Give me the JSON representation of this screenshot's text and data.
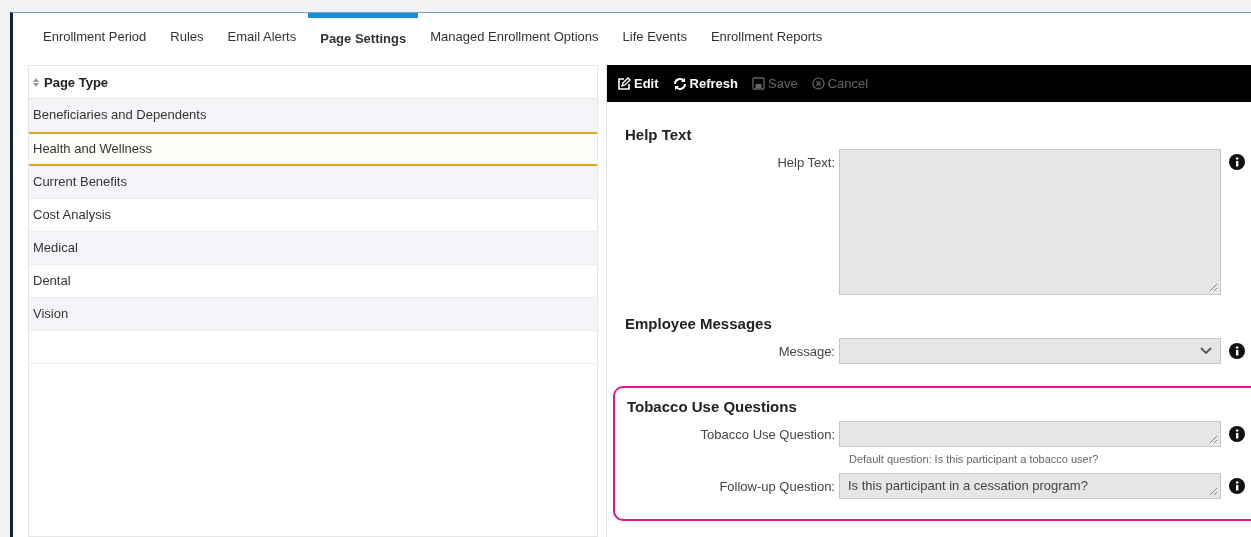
{
  "tabs": [
    {
      "label": "Enrollment Period",
      "selected": false
    },
    {
      "label": "Rules",
      "selected": false
    },
    {
      "label": "Email Alerts",
      "selected": false
    },
    {
      "label": "Page Settings",
      "selected": true
    },
    {
      "label": "Managed Enrollment Options",
      "selected": false
    },
    {
      "label": "Life Events",
      "selected": false
    },
    {
      "label": "Enrollment Reports",
      "selected": false
    }
  ],
  "page_list": {
    "header": "Page Type",
    "rows": [
      {
        "label": "Beneficiaries and Dependents",
        "selected": false
      },
      {
        "label": "Health and Wellness",
        "selected": true
      },
      {
        "label": "Current Benefits",
        "selected": false
      },
      {
        "label": "Cost Analysis",
        "selected": false
      },
      {
        "label": "Medical",
        "selected": false
      },
      {
        "label": "Dental",
        "selected": false
      },
      {
        "label": "Vision",
        "selected": false
      }
    ]
  },
  "toolbar": [
    {
      "kind": "edit",
      "label": "Edit",
      "disabled": false
    },
    {
      "kind": "refresh",
      "label": "Refresh",
      "disabled": false
    },
    {
      "kind": "save",
      "label": "Save",
      "disabled": true
    },
    {
      "kind": "cancel",
      "label": "Cancel",
      "disabled": true
    }
  ],
  "sections": [
    {
      "title": "Help Text",
      "highlighted": false,
      "fields": [
        {
          "kind": "textarea",
          "label": "Help Text:"
        }
      ]
    },
    {
      "title": "Employee Messages",
      "highlighted": false,
      "fields": [
        {
          "kind": "select",
          "label": "Message:"
        }
      ]
    },
    {
      "title": "Tobacco Use Questions",
      "highlighted": true,
      "fields": [
        {
          "kind": "textline",
          "label": "Tobacco Use Question:",
          "hint": "Default question: Is this participant a tobacco user?"
        },
        {
          "kind": "textline",
          "label": "Follow-up Question:",
          "value": "Is this participant in a cessation program?"
        }
      ]
    }
  ]
}
